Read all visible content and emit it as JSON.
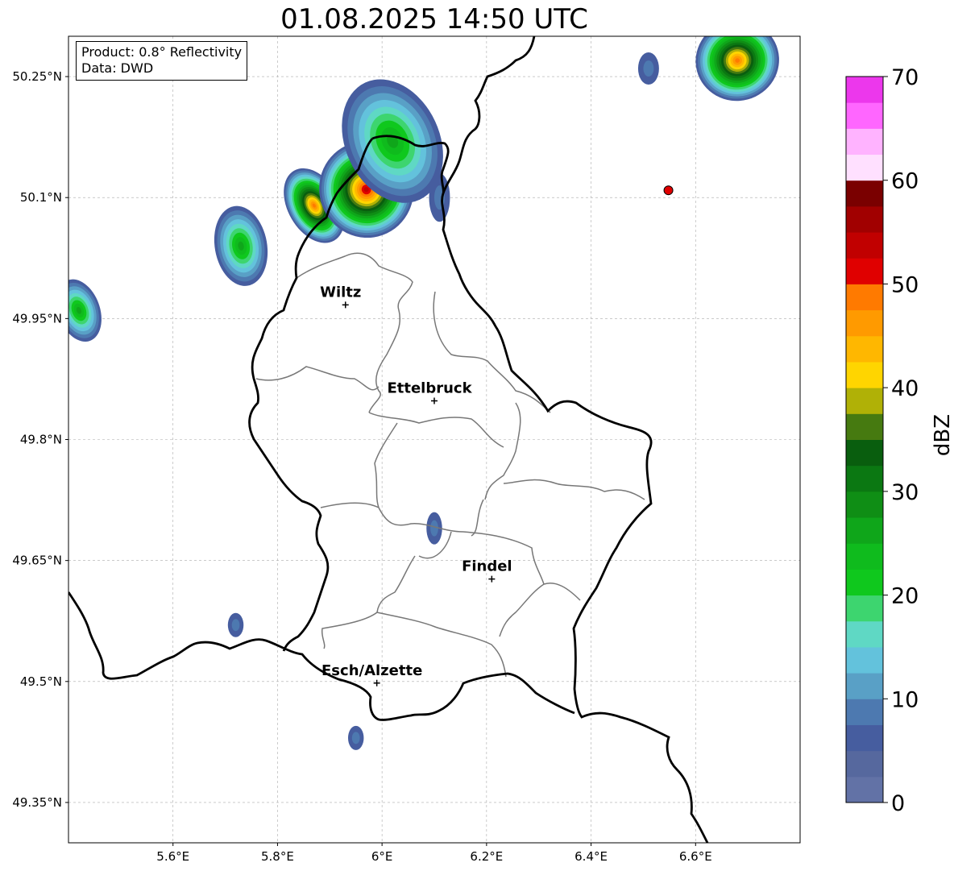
{
  "title": "01.08.2025 14:50 UTC",
  "info_box": {
    "product": "Product: 0.8° Reflectivity",
    "source": "Data: DWD"
  },
  "axes": {
    "lon_min": 5.4,
    "lon_max": 6.8,
    "lat_min": 49.3,
    "lat_max": 50.3,
    "lon_ticks": [
      {
        "value": 5.6,
        "label": "5.6°E"
      },
      {
        "value": 5.8,
        "label": "5.8°E"
      },
      {
        "value": 6.0,
        "label": "6°E"
      },
      {
        "value": 6.2,
        "label": "6.2°E"
      },
      {
        "value": 6.4,
        "label": "6.4°E"
      },
      {
        "value": 6.6,
        "label": "6.6°E"
      }
    ],
    "lat_ticks": [
      {
        "value": 50.25,
        "label": "50.25°N"
      },
      {
        "value": 50.1,
        "label": "50.1°N"
      },
      {
        "value": 49.95,
        "label": "49.95°N"
      },
      {
        "value": 49.8,
        "label": "49.8°N"
      },
      {
        "value": 49.65,
        "label": "49.65°N"
      },
      {
        "value": 49.5,
        "label": "49.5°N"
      },
      {
        "value": 49.35,
        "label": "49.35°N"
      }
    ],
    "grid": true
  },
  "cities": [
    {
      "name": "Wiltz",
      "lon": 5.93,
      "lat": 49.967
    },
    {
      "name": "Ettelbruck",
      "lon": 6.1,
      "lat": 49.848
    },
    {
      "name": "Findel",
      "lon": 6.21,
      "lat": 49.627
    },
    {
      "name": "Esch/Alzette",
      "lon": 5.99,
      "lat": 49.498
    }
  ],
  "radar_site": {
    "lon": 6.548,
    "lat": 50.109,
    "color": "#e00000"
  },
  "colorbar": {
    "label": "dBZ",
    "min": 0,
    "max": 70,
    "ticks": [
      {
        "value": 0,
        "label": "0"
      },
      {
        "value": 10,
        "label": "10"
      },
      {
        "value": 20,
        "label": "20"
      },
      {
        "value": 30,
        "label": "30"
      },
      {
        "value": 40,
        "label": "40"
      },
      {
        "value": 50,
        "label": "50"
      },
      {
        "value": 60,
        "label": "60"
      },
      {
        "value": 70,
        "label": "70"
      }
    ],
    "colors": [
      "#6272a6",
      "#56689e",
      "#465d9f",
      "#4d79b0",
      "#59a0c6",
      "#63c2dc",
      "#5fd8c4",
      "#3dd56f",
      "#0fc81d",
      "#0fbb1d",
      "#0fa61a",
      "#0f8e15",
      "#0b7812",
      "#095e0e",
      "#467a10",
      "#b0b106",
      "#ffd500",
      "#ffb700",
      "#ff9a00",
      "#ff7a00",
      "#e00000",
      "#c10000",
      "#a10000",
      "#7a0000",
      "#ffe0ff",
      "#ffb3ff",
      "#ff66ff",
      "#ec37ec"
    ]
  },
  "echoes": [
    {
      "lon": 5.87,
      "lat": 50.09,
      "rx": 0.05,
      "ry": 0.05,
      "peak": 45,
      "rot": -30
    },
    {
      "lon": 5.97,
      "lat": 50.11,
      "rx": 0.09,
      "ry": 0.06,
      "peak": 50,
      "rot": -20
    },
    {
      "lon": 6.02,
      "lat": 50.17,
      "rx": 0.09,
      "ry": 0.08,
      "peak": 22,
      "rot": -25
    },
    {
      "lon": 5.73,
      "lat": 50.04,
      "rx": 0.05,
      "ry": 0.05,
      "peak": 22,
      "rot": -10
    },
    {
      "lon": 5.42,
      "lat": 49.96,
      "rx": 0.04,
      "ry": 0.04,
      "peak": 22,
      "rot": -20
    },
    {
      "lon": 6.68,
      "lat": 50.27,
      "rx": 0.08,
      "ry": 0.05,
      "peak": 45,
      "rot": -15
    },
    {
      "lon": 6.51,
      "lat": 50.26,
      "rx": 0.02,
      "ry": 0.02,
      "peak": 6,
      "rot": 0
    },
    {
      "lon": 6.11,
      "lat": 50.1,
      "rx": 0.02,
      "ry": 0.03,
      "peak": 6,
      "rot": 0
    },
    {
      "lon": 6.1,
      "lat": 49.69,
      "rx": 0.015,
      "ry": 0.02,
      "peak": 6,
      "rot": 0
    },
    {
      "lon": 5.72,
      "lat": 49.57,
      "rx": 0.015,
      "ry": 0.015,
      "peak": 6,
      "rot": 0
    },
    {
      "lon": 5.95,
      "lat": 49.43,
      "rx": 0.015,
      "ry": 0.015,
      "peak": 6,
      "rot": 0
    }
  ]
}
